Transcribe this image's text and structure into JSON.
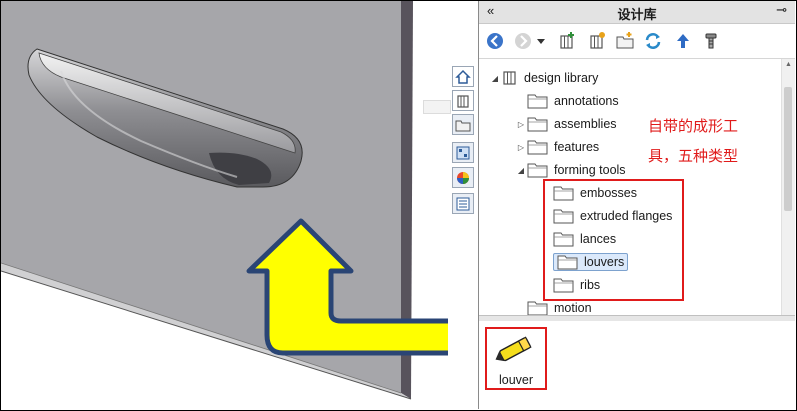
{
  "panel": {
    "title": "设计库",
    "collapse_icon": "chevron-left-double-icon",
    "pin_icon": "pin-icon"
  },
  "toolbar": {
    "icons": [
      "back-arrow-icon",
      "forward-arrow-icon",
      "dropdown-arrow-icon",
      "add-to-library-icon",
      "add-file-location-icon",
      "create-new-folder-icon",
      "refresh-icon",
      "up-one-level-icon",
      "3dcontentcentral-icon"
    ]
  },
  "tree": {
    "root_label": "design library",
    "items": [
      {
        "label": "annotations"
      },
      {
        "label": "assemblies"
      },
      {
        "label": "features"
      },
      {
        "label": "forming tools"
      },
      {
        "label": "embosses"
      },
      {
        "label": "extruded flanges"
      },
      {
        "label": "lances"
      },
      {
        "label": "louvers"
      },
      {
        "label": "ribs"
      },
      {
        "label": "motion"
      }
    ]
  },
  "preview": {
    "item_label": "louver"
  },
  "annotation": {
    "line1": "自带的成形工",
    "line2": "具，五种类型"
  },
  "colors": {
    "highlight": "#e01b1b",
    "arrow_fill": "#ffff00",
    "arrow_outline": "#2a4575",
    "sheet_gray": "#a4a4a8"
  }
}
